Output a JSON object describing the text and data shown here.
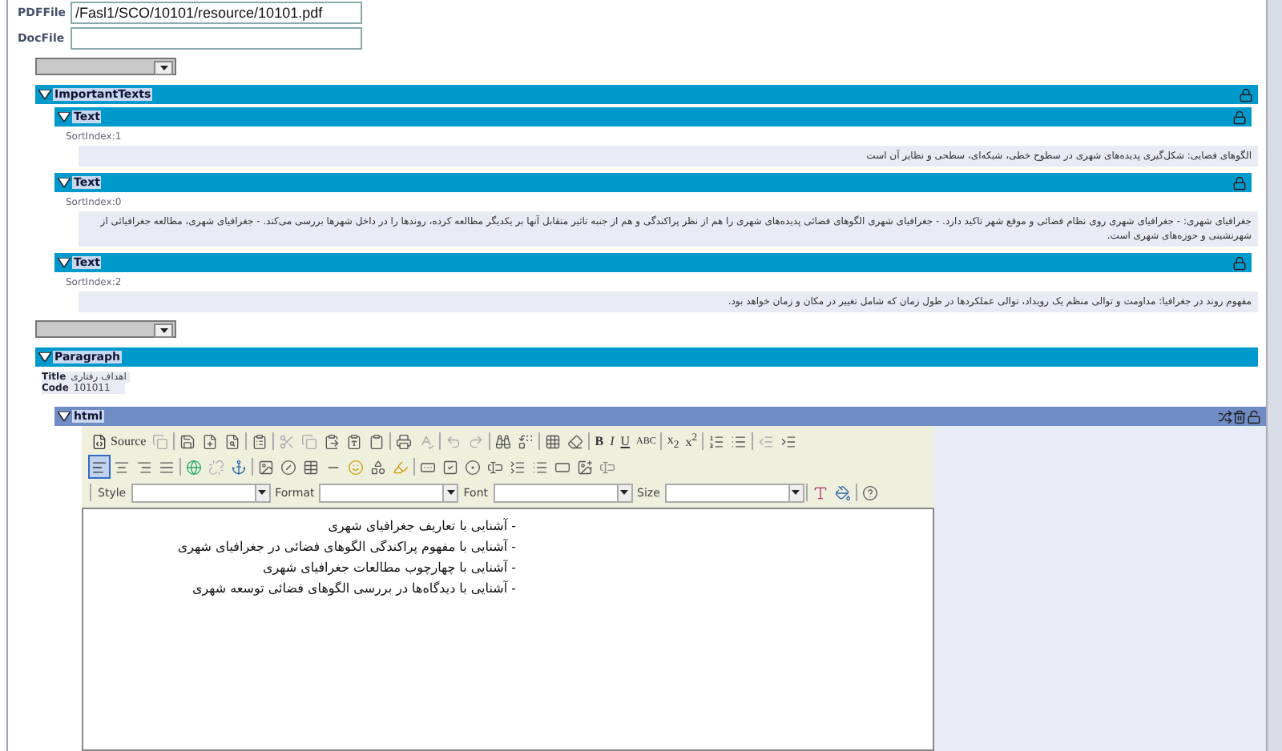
{
  "fields": [
    {
      "label": "PDFFile",
      "value": "/Fasl1/SCO/10101/resource/10101.pdf"
    },
    {
      "label": "DocFile"
    }
  ],
  "important_texts": {
    "title": "ImportantTexts",
    "expanded": true,
    "items": [
      {
        "title": "Text",
        "expanded": true,
        "sort_index": "SortIndex:1",
        "text": "الگوهای فضایی: شکل‌گیری پدیده‌های شهری در سطوح خطی، شبکه‌ای، سطحی و نظایر آن است"
      },
      {
        "title": "Text",
        "expanded": true,
        "sort_index": "SortIndex:0",
        "text": "جغرافیای شهری: - جغرافیای شهری روی نظام فضائی و موقع شهر تاکید دارد. - جغرافیای شهری الگوهای فضائی پدیده‌های شهری را هم از نظر پراکندگی و هم از جنبه تاثیر متقابل آنها بر یکدیگر مطالعه کرده، روندها را در داخل شهرها بررسی می‌کند. - جغرافیای شهری، مطالعه جغرافیائی از شهرنشینی و حوزه‌های شهری است."
      },
      {
        "title": "Text",
        "expanded": true,
        "sort_index": "SortIndex:2",
        "text": "مفهوم روند در جغرافیا: مداومت و توالی منظم یک رویداد، توالی عملکردها در طول زمان که شامل تغییر در مکان و زمان خواهد بود."
      }
    ]
  },
  "paragraph": {
    "title": "Paragraph",
    "expanded": true,
    "props": [
      {
        "label": "Title",
        "value": "اهداف رفتاری"
      },
      {
        "label": "Code",
        "value": "101011"
      }
    ],
    "html": {
      "title": "html",
      "expanded": true,
      "toolbar": {
        "source": "Source",
        "bold": "B",
        "italic": "I",
        "underline": "U",
        "strike": "ABC",
        "subscript": "x",
        "sub_mark": "2",
        "superscript": "x",
        "sup_mark": "2",
        "style": "Style",
        "format": "Format",
        "font": "Font",
        "size": "Size"
      },
      "lines": [
        "- آشنایی با تعاریف جغرافیای شهری",
        "- آشنایی با مفهوم پراکندگی الگوهای فضائی در جغرافیای شهری",
        "- آشنایی با چهارچوب مطالعات جغرافیای شهری",
        "- آشنایی با دیدگاه‌ها در بررسی الگوهای فضائی توسعه شهری"
      ]
    }
  }
}
